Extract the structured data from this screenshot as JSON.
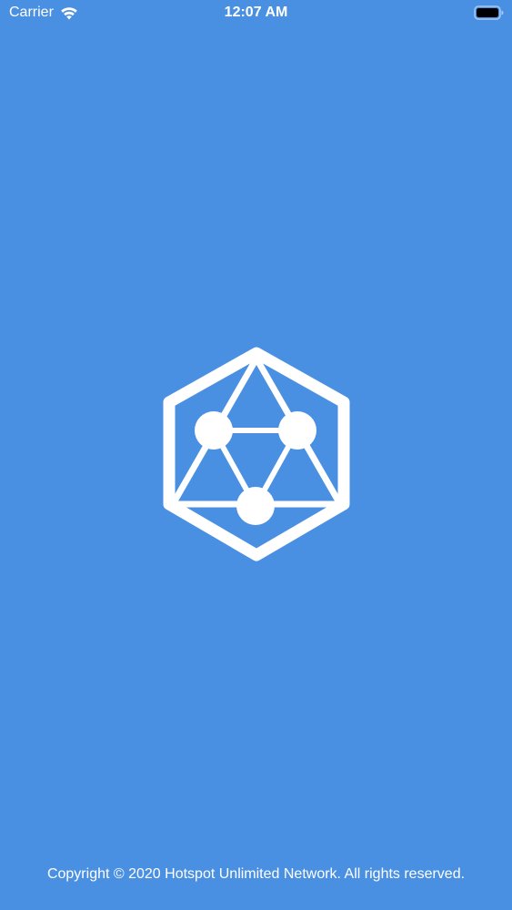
{
  "status_bar": {
    "carrier": "Carrier",
    "time": "12:07 AM",
    "wifi_icon": "wifi-icon",
    "battery_icon": "battery-icon"
  },
  "splash": {
    "background_color": "#4a90e2",
    "logo_icon": "hexagon-network-logo",
    "logo_color": "#ffffff"
  },
  "footer": {
    "copyright": "Copyright © 2020 Hotspot Unlimited Network. All rights reserved."
  }
}
